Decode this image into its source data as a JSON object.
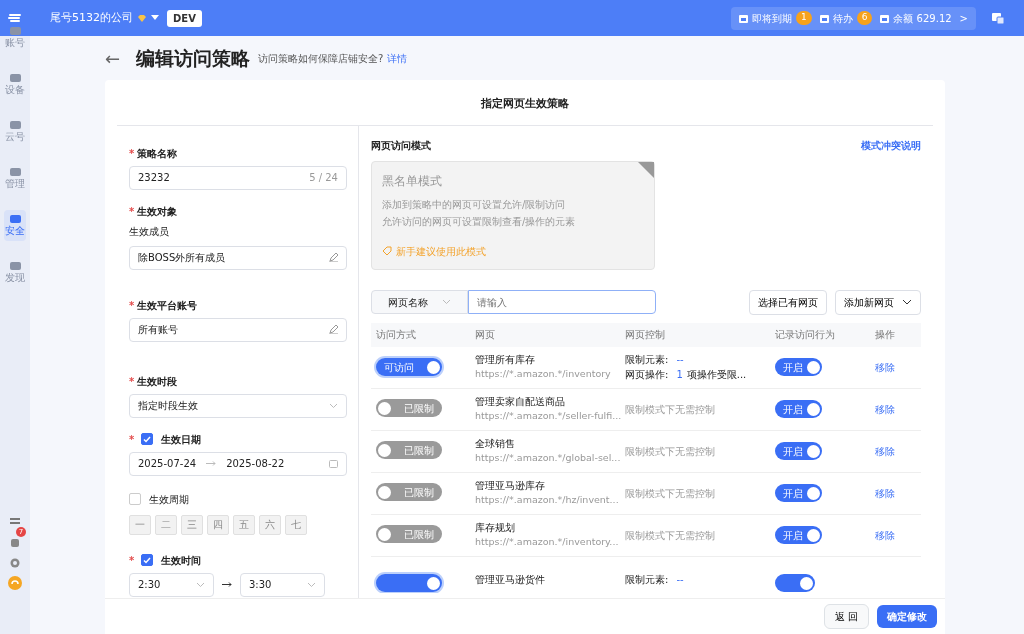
{
  "topbar": {
    "company": "尾号5132的公司",
    "env": "DEV",
    "stats": [
      {
        "label": "即将到期",
        "count": "1"
      },
      {
        "label": "待办",
        "count": "6"
      },
      {
        "label": "余额 629.12"
      }
    ],
    "more": ">"
  },
  "sidebar": {
    "items": [
      {
        "label": "账号",
        "selected": false
      },
      {
        "label": "设备",
        "selected": false
      },
      {
        "label": "云号",
        "selected": false
      },
      {
        "label": "管理",
        "selected": false
      },
      {
        "label": "安全",
        "selected": true
      },
      {
        "label": "发现",
        "selected": false
      }
    ],
    "notifications": "7"
  },
  "header": {
    "back": "←",
    "title": "编辑访问策略",
    "hint": "访问策略如何保障店铺安全?",
    "link": "详情"
  },
  "card_title": "指定网页生效策略",
  "form": {
    "marks": [
      "*",
      "*",
      "*",
      "*",
      "*",
      "*"
    ],
    "name_label": "策略名称",
    "name_value": "23232",
    "name_count": "5 / 24",
    "target_label": "生效对象",
    "members_label": "生效成员",
    "members_value": "除BOSS外所有成员",
    "accounts_label": "生效平台账号",
    "accounts_value": "所有账号",
    "period_label": "生效时段",
    "period_value": "指定时段生效",
    "date": {
      "label": "生效日期",
      "checked": true,
      "start": "2025-07-24",
      "end": "2025-08-22"
    },
    "cycle": {
      "label": "生效周期",
      "checked": false,
      "days": [
        "一",
        "二",
        "三",
        "四",
        "五",
        "六",
        "七"
      ]
    },
    "time": {
      "label": "生效时间",
      "checked": true,
      "start": "2:30",
      "end": "3:30"
    }
  },
  "mode": {
    "label": "网页访问模式",
    "conflict_link": "模式冲突说明",
    "card_title": "黑名单模式",
    "lines": [
      "添加到策略中的网页可设置允许/限制访问",
      "允许访问的网页可设置限制查看/操作的元素"
    ],
    "tip": "新手建议使用此模式"
  },
  "search": {
    "field": "网页名称",
    "placeholder": "请输入",
    "select_button": "选择已有网页",
    "add_button": "添加新网页"
  },
  "table": {
    "columns": [
      "访问方式",
      "网页",
      "网页控制",
      "记录访问行为",
      "操作"
    ],
    "rows": [
      {
        "access_on": true,
        "access_label": "可访问",
        "name": "管理所有库存",
        "url": "https://*.amazon.*/inventory",
        "kind": "controlled",
        "elements_label": "限制元素:",
        "elements_value": "--",
        "ops_label": "网页操作:",
        "ops_count": "1",
        "ops_text": "项操作受限...",
        "record_on": true,
        "record_label": "开启",
        "action": "移除"
      },
      {
        "access_on": false,
        "access_label": "已限制",
        "name": "管理卖家自配送商品",
        "url": "https://*.amazon.*/seller-fulfi...",
        "kind": "restricted",
        "control_text": "限制模式下无需控制",
        "record_on": true,
        "record_label": "开启",
        "action": "移除"
      },
      {
        "access_on": false,
        "access_label": "已限制",
        "name": "全球销售",
        "url": "https://*.amazon.*/global-sel...",
        "kind": "restricted",
        "control_text": "限制模式下无需控制",
        "record_on": true,
        "record_label": "开启",
        "action": "移除"
      },
      {
        "access_on": false,
        "access_label": "已限制",
        "name": "管理亚马逊库存",
        "url": "https://*.amazon.*/hz/invent...",
        "kind": "restricted",
        "control_text": "限制模式下无需控制",
        "record_on": true,
        "record_label": "开启",
        "action": "移除"
      },
      {
        "access_on": false,
        "access_label": "已限制",
        "name": "库存规划",
        "url": "https://*.amazon.*/inventory...",
        "kind": "restricted",
        "control_text": "限制模式下无需控制",
        "record_on": true,
        "record_label": "开启",
        "action": "移除"
      },
      {
        "access_on": true,
        "name": "管理亚马逊货件",
        "kind": "controlled",
        "elements_label": "限制元素:",
        "elements_value": "--",
        "record_on": true
      }
    ]
  },
  "footer": {
    "back": "返 回",
    "confirm": "确定修改"
  }
}
